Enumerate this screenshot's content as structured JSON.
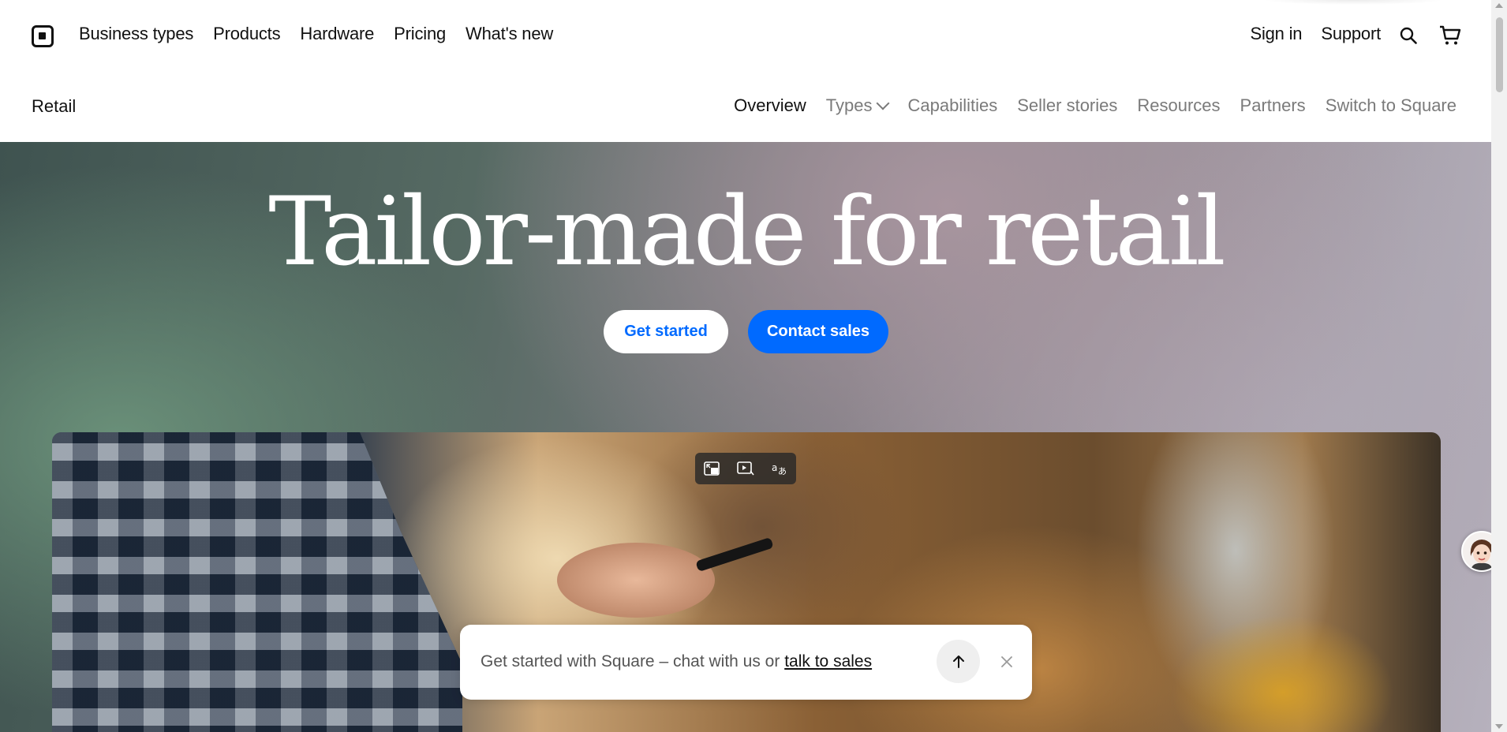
{
  "header": {
    "logo_name": "square-logo",
    "nav_links": [
      "Business types",
      "Products",
      "Hardware",
      "Pricing",
      "What's new"
    ],
    "right_links": [
      "Sign in",
      "Support"
    ]
  },
  "subnav": {
    "section": "Retail",
    "links": [
      "Overview",
      "Types",
      "Capabilities",
      "Seller stories",
      "Resources",
      "Partners",
      "Switch to Square"
    ],
    "active": "Overview"
  },
  "hero": {
    "title": "Tailor-made for retail",
    "primary_button": "Get started",
    "secondary_button": "Contact sales"
  },
  "chat": {
    "text": "Get started with Square – chat with us or ",
    "link": "talk to sales"
  },
  "colors": {
    "accent": "#006aff",
    "text": "#1a1a1a",
    "muted": "#7a7a7a"
  }
}
